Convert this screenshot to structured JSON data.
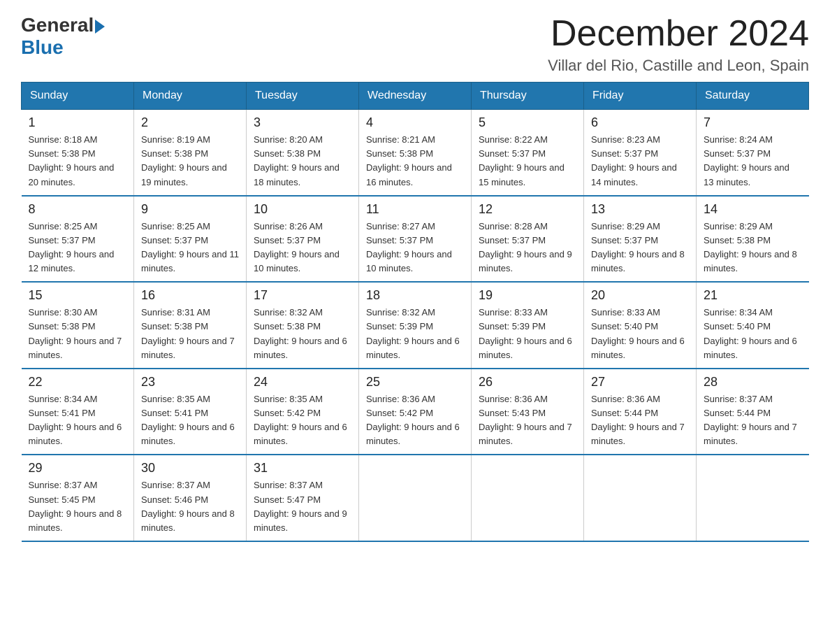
{
  "header": {
    "logo_general": "General",
    "logo_blue": "Blue",
    "title": "December 2024",
    "subtitle": "Villar del Rio, Castille and Leon, Spain"
  },
  "calendar": {
    "days_of_week": [
      "Sunday",
      "Monday",
      "Tuesday",
      "Wednesday",
      "Thursday",
      "Friday",
      "Saturday"
    ],
    "weeks": [
      [
        {
          "day": "1",
          "sunrise": "8:18 AM",
          "sunset": "5:38 PM",
          "daylight": "9 hours and 20 minutes."
        },
        {
          "day": "2",
          "sunrise": "8:19 AM",
          "sunset": "5:38 PM",
          "daylight": "9 hours and 19 minutes."
        },
        {
          "day": "3",
          "sunrise": "8:20 AM",
          "sunset": "5:38 PM",
          "daylight": "9 hours and 18 minutes."
        },
        {
          "day": "4",
          "sunrise": "8:21 AM",
          "sunset": "5:38 PM",
          "daylight": "9 hours and 16 minutes."
        },
        {
          "day": "5",
          "sunrise": "8:22 AM",
          "sunset": "5:37 PM",
          "daylight": "9 hours and 15 minutes."
        },
        {
          "day": "6",
          "sunrise": "8:23 AM",
          "sunset": "5:37 PM",
          "daylight": "9 hours and 14 minutes."
        },
        {
          "day": "7",
          "sunrise": "8:24 AM",
          "sunset": "5:37 PM",
          "daylight": "9 hours and 13 minutes."
        }
      ],
      [
        {
          "day": "8",
          "sunrise": "8:25 AM",
          "sunset": "5:37 PM",
          "daylight": "9 hours and 12 minutes."
        },
        {
          "day": "9",
          "sunrise": "8:25 AM",
          "sunset": "5:37 PM",
          "daylight": "9 hours and 11 minutes."
        },
        {
          "day": "10",
          "sunrise": "8:26 AM",
          "sunset": "5:37 PM",
          "daylight": "9 hours and 10 minutes."
        },
        {
          "day": "11",
          "sunrise": "8:27 AM",
          "sunset": "5:37 PM",
          "daylight": "9 hours and 10 minutes."
        },
        {
          "day": "12",
          "sunrise": "8:28 AM",
          "sunset": "5:37 PM",
          "daylight": "9 hours and 9 minutes."
        },
        {
          "day": "13",
          "sunrise": "8:29 AM",
          "sunset": "5:37 PM",
          "daylight": "9 hours and 8 minutes."
        },
        {
          "day": "14",
          "sunrise": "8:29 AM",
          "sunset": "5:38 PM",
          "daylight": "9 hours and 8 minutes."
        }
      ],
      [
        {
          "day": "15",
          "sunrise": "8:30 AM",
          "sunset": "5:38 PM",
          "daylight": "9 hours and 7 minutes."
        },
        {
          "day": "16",
          "sunrise": "8:31 AM",
          "sunset": "5:38 PM",
          "daylight": "9 hours and 7 minutes."
        },
        {
          "day": "17",
          "sunrise": "8:32 AM",
          "sunset": "5:38 PM",
          "daylight": "9 hours and 6 minutes."
        },
        {
          "day": "18",
          "sunrise": "8:32 AM",
          "sunset": "5:39 PM",
          "daylight": "9 hours and 6 minutes."
        },
        {
          "day": "19",
          "sunrise": "8:33 AM",
          "sunset": "5:39 PM",
          "daylight": "9 hours and 6 minutes."
        },
        {
          "day": "20",
          "sunrise": "8:33 AM",
          "sunset": "5:40 PM",
          "daylight": "9 hours and 6 minutes."
        },
        {
          "day": "21",
          "sunrise": "8:34 AM",
          "sunset": "5:40 PM",
          "daylight": "9 hours and 6 minutes."
        }
      ],
      [
        {
          "day": "22",
          "sunrise": "8:34 AM",
          "sunset": "5:41 PM",
          "daylight": "9 hours and 6 minutes."
        },
        {
          "day": "23",
          "sunrise": "8:35 AM",
          "sunset": "5:41 PM",
          "daylight": "9 hours and 6 minutes."
        },
        {
          "day": "24",
          "sunrise": "8:35 AM",
          "sunset": "5:42 PM",
          "daylight": "9 hours and 6 minutes."
        },
        {
          "day": "25",
          "sunrise": "8:36 AM",
          "sunset": "5:42 PM",
          "daylight": "9 hours and 6 minutes."
        },
        {
          "day": "26",
          "sunrise": "8:36 AM",
          "sunset": "5:43 PM",
          "daylight": "9 hours and 7 minutes."
        },
        {
          "day": "27",
          "sunrise": "8:36 AM",
          "sunset": "5:44 PM",
          "daylight": "9 hours and 7 minutes."
        },
        {
          "day": "28",
          "sunrise": "8:37 AM",
          "sunset": "5:44 PM",
          "daylight": "9 hours and 7 minutes."
        }
      ],
      [
        {
          "day": "29",
          "sunrise": "8:37 AM",
          "sunset": "5:45 PM",
          "daylight": "9 hours and 8 minutes."
        },
        {
          "day": "30",
          "sunrise": "8:37 AM",
          "sunset": "5:46 PM",
          "daylight": "9 hours and 8 minutes."
        },
        {
          "day": "31",
          "sunrise": "8:37 AM",
          "sunset": "5:47 PM",
          "daylight": "9 hours and 9 minutes."
        },
        null,
        null,
        null,
        null
      ]
    ]
  }
}
